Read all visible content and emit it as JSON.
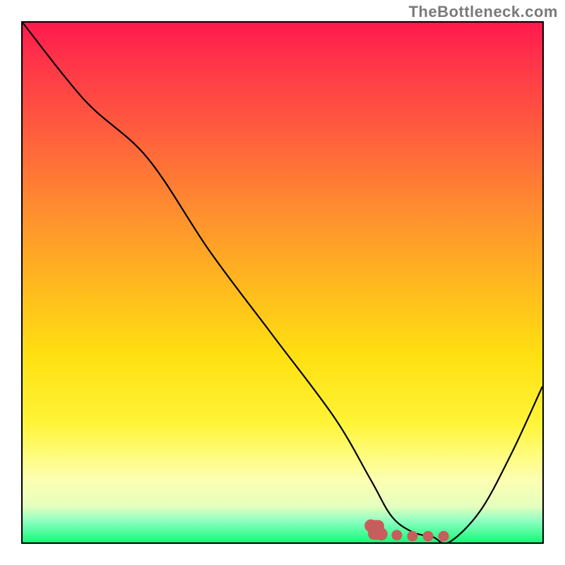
{
  "attribution": "TheBottleneck.com",
  "chart_data": {
    "type": "line",
    "title": "",
    "xlabel": "",
    "ylabel": "",
    "xlim": [
      0,
      100
    ],
    "ylim": [
      0,
      100
    ],
    "series": [
      {
        "name": "bottleneck-curve",
        "x": [
          0,
          12,
          24,
          36,
          48,
          60,
          67,
          71,
          75,
          79,
          82,
          88,
          94,
          100
        ],
        "y": [
          100,
          85,
          74,
          56,
          40,
          24,
          12,
          5,
          2,
          1,
          0,
          6,
          17,
          30
        ]
      }
    ],
    "markers": {
      "name": "sweet-spot-marker",
      "color": "#c75d5d",
      "points": [
        {
          "x": 67,
          "y": 3.2
        },
        {
          "x": 68,
          "y": 2.6
        },
        {
          "x": 69,
          "y": 1.6
        },
        {
          "x": 72,
          "y": 1.4
        },
        {
          "x": 75,
          "y": 1.2
        },
        {
          "x": 78,
          "y": 1.2
        },
        {
          "x": 81,
          "y": 1.2
        }
      ]
    },
    "background_gradient": {
      "top": "#ff1a4d",
      "mid": "#ffe011",
      "bottom": "#17f878"
    }
  }
}
